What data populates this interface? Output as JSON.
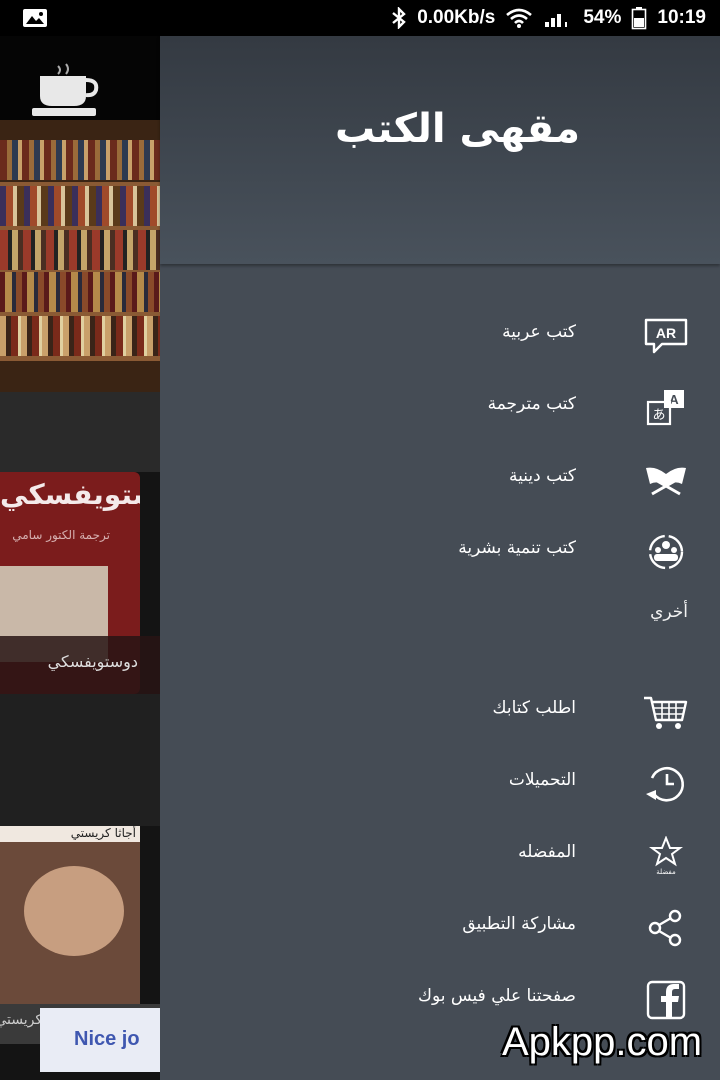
{
  "status_bar": {
    "network_speed": "0.00Kb/s",
    "battery": "54%",
    "time": "10:19",
    "icons": [
      "image-icon",
      "bluetooth-icon",
      "wifi-icon",
      "signal-icon",
      "battery-icon"
    ]
  },
  "background": {
    "book1_title": "دوستويفسكي",
    "book1_subtitle": "ترجمة الكتور سامي",
    "book1_caption": "دوستويفسكي",
    "book2_author": "أجاثا كريستي",
    "book2_caption": "كريستي",
    "toast": "Nice jo"
  },
  "drawer": {
    "title": "مقهى الكتب",
    "items": [
      {
        "label": "كتب عربية",
        "icon": "ar-badge-icon"
      },
      {
        "label": "كتب مترجمة",
        "icon": "translate-icon"
      },
      {
        "label": "كتب دينية",
        "icon": "quran-stand-icon"
      },
      {
        "label": "كتب تنمية بشرية",
        "icon": "group-circle-icon"
      }
    ],
    "section_other": "أخري",
    "other_items": [
      {
        "label": "اطلب كتابك",
        "icon": "cart-icon"
      },
      {
        "label": "التحميلات",
        "icon": "history-icon"
      },
      {
        "label": "المفضله",
        "icon": "star-icon",
        "icon_caption": "مفضلة"
      },
      {
        "label": "مشاركة التطبيق",
        "icon": "share-icon"
      },
      {
        "label": "صفحتنا علي فيس بوك",
        "icon": "facebook-icon"
      }
    ]
  },
  "watermark": "Apkpp.com"
}
